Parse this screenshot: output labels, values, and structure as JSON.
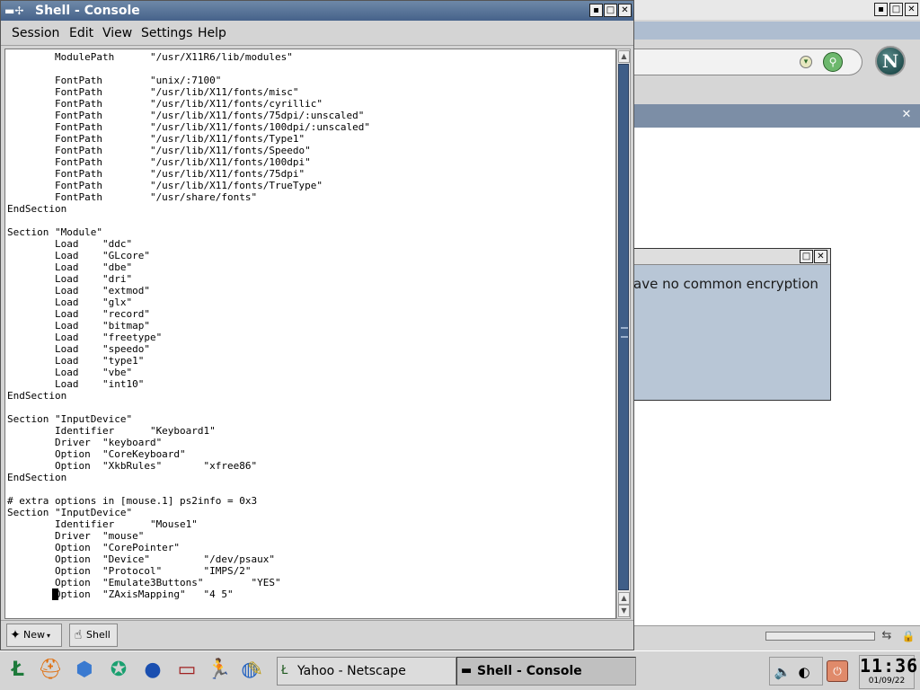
{
  "konsole": {
    "title": "Shell - Console",
    "menu": [
      "Session",
      "Edit",
      "View",
      "Settings",
      "Help"
    ],
    "terminal_text": "        ModulePath      \"/usr/X11R6/lib/modules\"\n\n        FontPath        \"unix/:7100\"\n        FontPath        \"/usr/lib/X11/fonts/misc\"\n        FontPath        \"/usr/lib/X11/fonts/cyrillic\"\n        FontPath        \"/usr/lib/X11/fonts/75dpi/:unscaled\"\n        FontPath        \"/usr/lib/X11/fonts/100dpi/:unscaled\"\n        FontPath        \"/usr/lib/X11/fonts/Type1\"\n        FontPath        \"/usr/lib/X11/fonts/Speedo\"\n        FontPath        \"/usr/lib/X11/fonts/100dpi\"\n        FontPath        \"/usr/lib/X11/fonts/75dpi\"\n        FontPath        \"/usr/lib/X11/fonts/TrueType\"\n        FontPath        \"/usr/share/fonts\"\nEndSection\n\nSection \"Module\"\n        Load    \"ddc\"\n        Load    \"GLcore\"\n        Load    \"dbe\"\n        Load    \"dri\"\n        Load    \"extmod\"\n        Load    \"glx\"\n        Load    \"record\"\n        Load    \"bitmap\"\n        Load    \"freetype\"\n        Load    \"speedo\"\n        Load    \"type1\"\n        Load    \"vbe\"\n        Load    \"int10\"\nEndSection\n\nSection \"InputDevice\"\n        Identifier      \"Keyboard1\"\n        Driver  \"keyboard\"\n        Option  \"CoreKeyboard\"\n        Option  \"XkbRules\"       \"xfree86\"\nEndSection\n\n# extra options in [mouse.1] ps2info = 0x3\nSection \"InputDevice\"\n        Identifier      \"Mouse1\"\n        Driver  \"mouse\"\n        Option  \"CorePointer\"\n        Option  \"Device\"         \"/dev/psaux\"\n        Option  \"Protocol\"       \"IMPS/2\"\n        Option  \"Emulate3Buttons\"        \"YES\"\n        Option  \"ZAxisMapping\"   \"4 5\"",
    "tabs": {
      "new_label": "New",
      "shell_label": "Shell"
    }
  },
  "dialog": {
    "message": "ave no common encryption"
  },
  "taskbar": {
    "tasks": [
      {
        "label": "Yahoo - Netscape",
        "active": false
      },
      {
        "label": "Shell - Console",
        "active": true
      }
    ],
    "clock": {
      "time": "11:36",
      "date": "01/09/22"
    }
  },
  "icons": {
    "launchers": [
      "kde-menu-icon",
      "lifevest-icon",
      "cube-icon",
      "runner-icon",
      "globe-icon",
      "scanner-icon",
      "running-man-icon",
      "earth-icon",
      "brush-icon"
    ]
  },
  "colors": {
    "titlebar_active": "#46628a",
    "dialog_bg": "#b8c6d6",
    "sidebar_bar": "#7c8ea6",
    "scroll_thumb": "#3f5e88"
  }
}
